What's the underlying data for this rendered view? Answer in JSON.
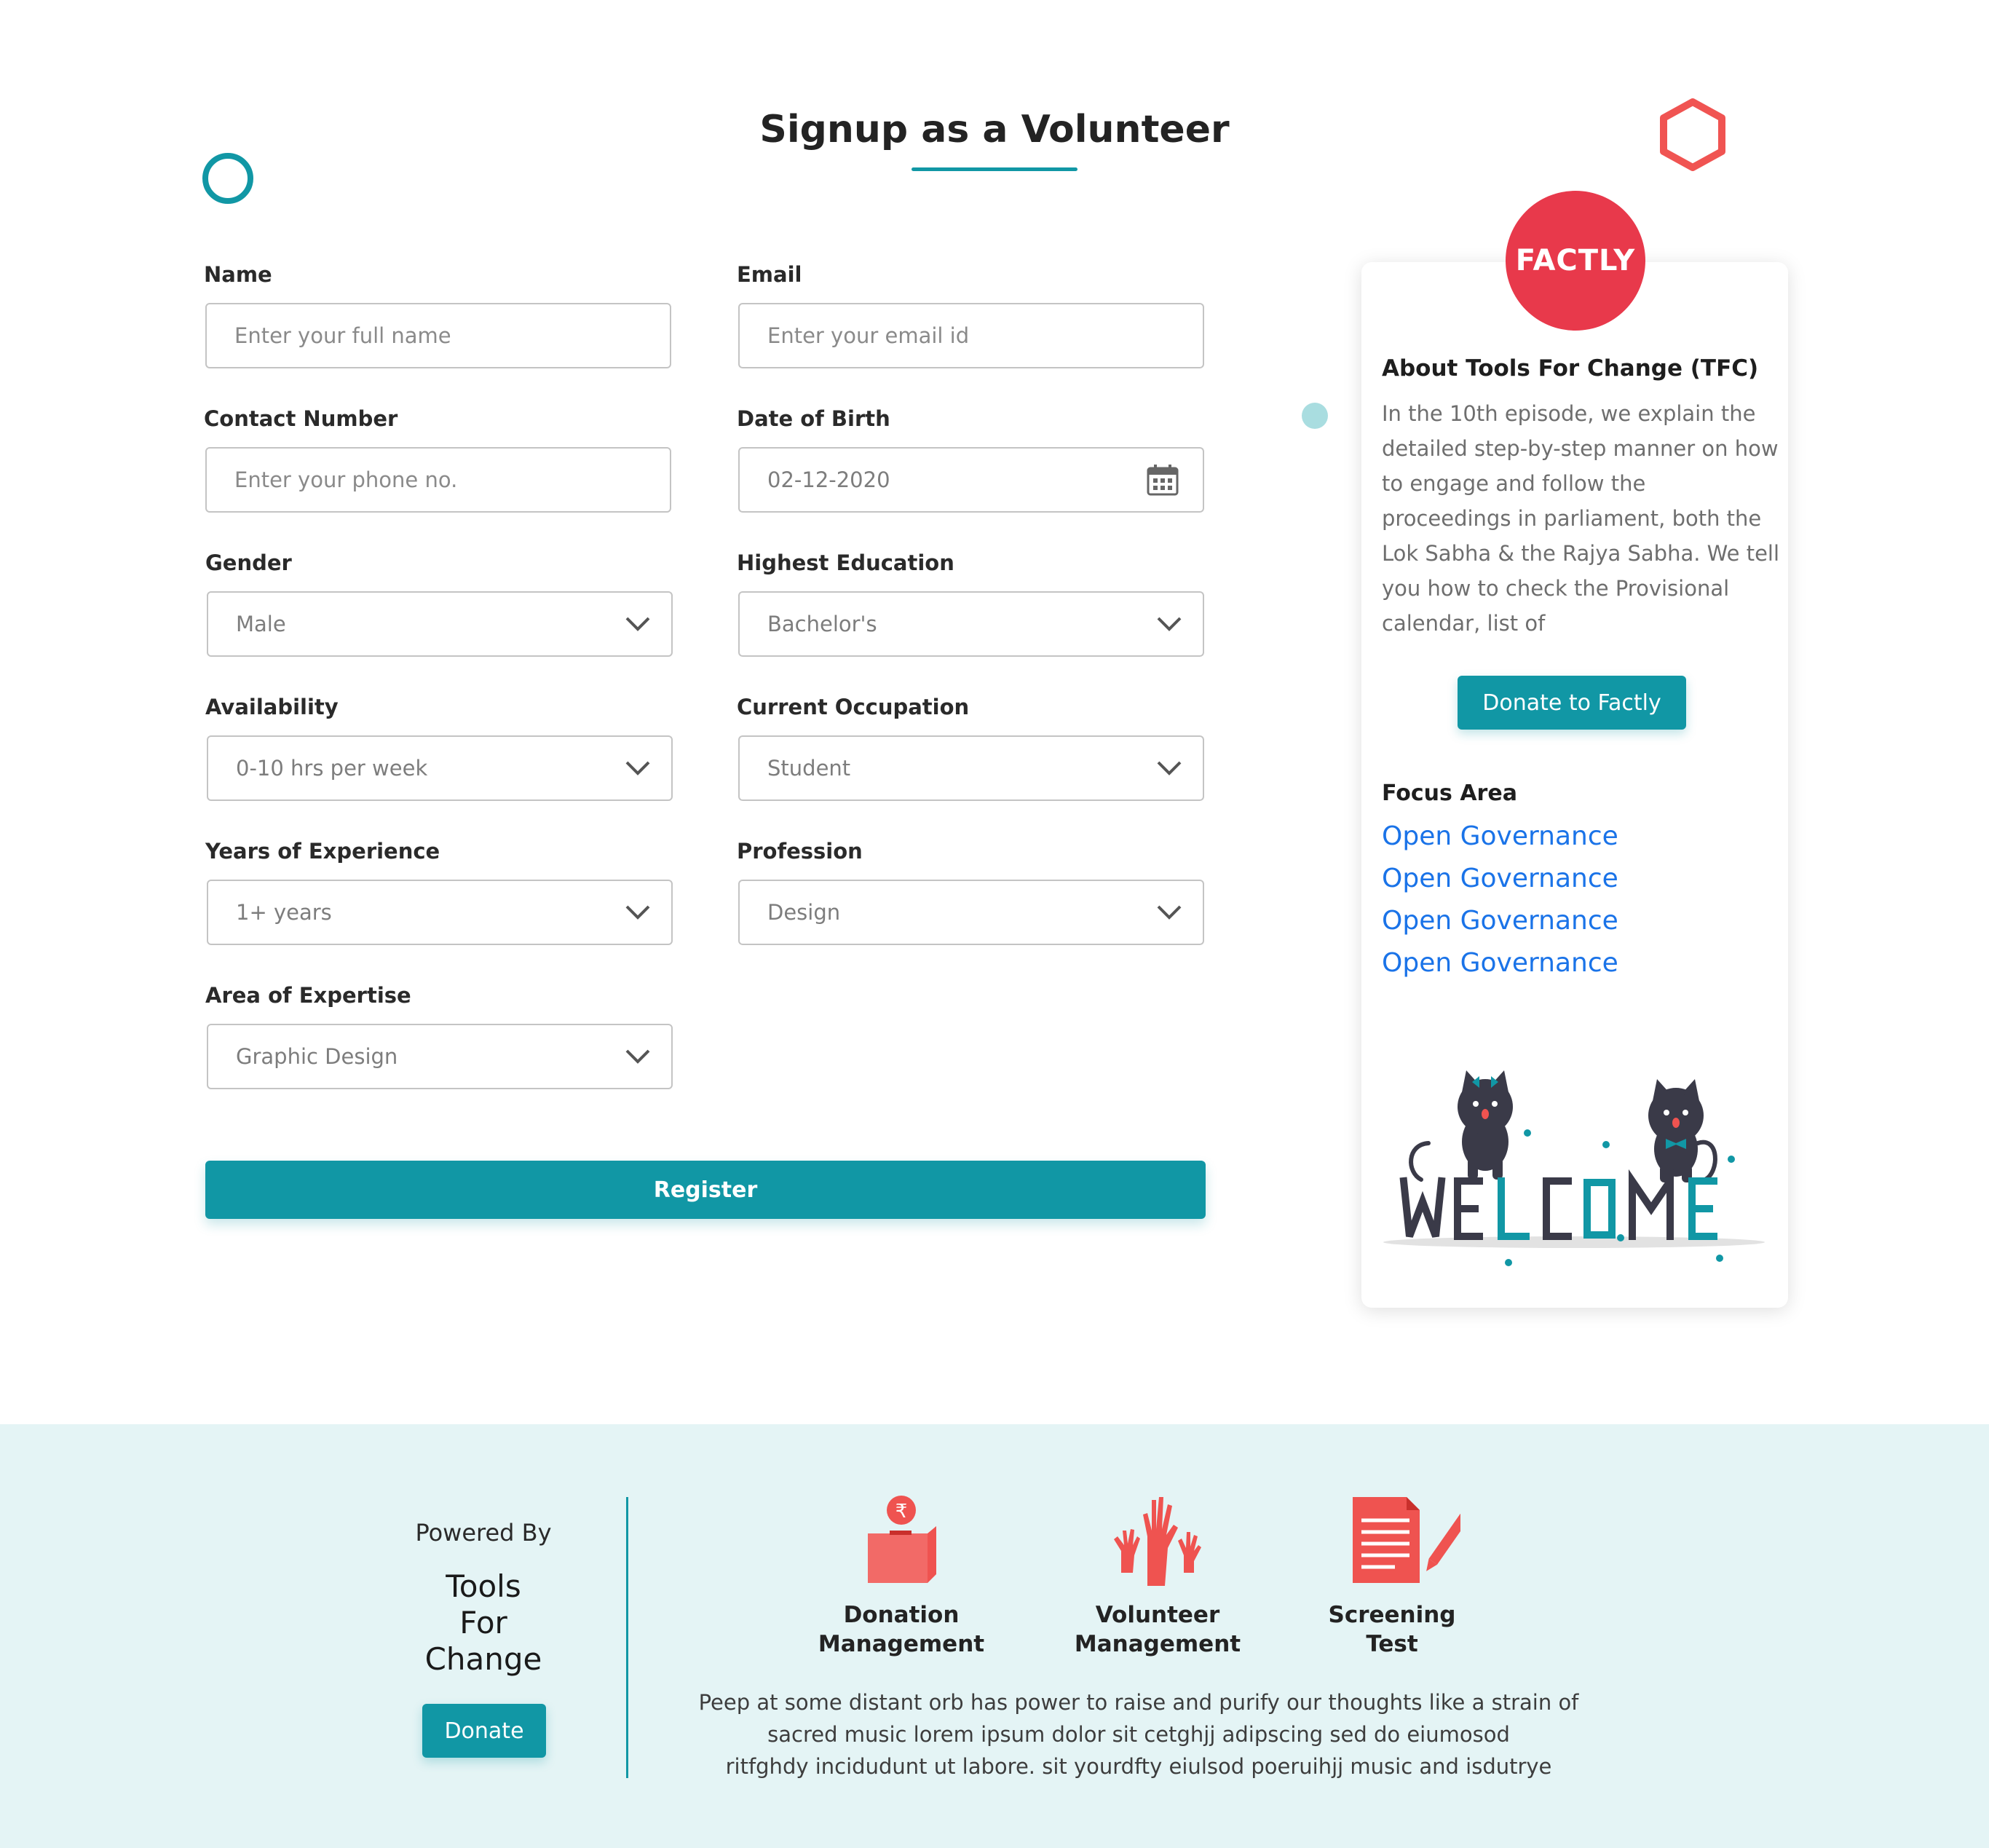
{
  "page": {
    "title": "Signup as a Volunteer"
  },
  "form": {
    "name": {
      "label": "Name",
      "placeholder": "Enter your full name"
    },
    "email": {
      "label": "Email",
      "placeholder": "Enter your email id"
    },
    "contact": {
      "label": "Contact Number",
      "placeholder": "Enter your phone no."
    },
    "dob": {
      "label": "Date of Birth",
      "value": "02-12-2020"
    },
    "gender": {
      "label": "Gender",
      "value": "Male"
    },
    "education": {
      "label": "Highest Education",
      "value": "Bachelor's"
    },
    "availability": {
      "label": "Availability",
      "value": "0-10 hrs per week"
    },
    "occupation": {
      "label": "Current Occupation",
      "value": "Student"
    },
    "experience": {
      "label": "Years of Experience",
      "value": "1+ years"
    },
    "profession": {
      "label": "Profession",
      "value": "Design"
    },
    "expertise": {
      "label": "Area of Expertise",
      "value": "Graphic Design"
    },
    "register_label": "Register"
  },
  "sidebar": {
    "logo_text": "FACTLY",
    "about_title": "About Tools For Change (TFC)",
    "about_text": "In the 10th episode, we explain the detailed step-by-step manner on how to engage and follow the proceedings in parliament, both the Lok Sabha & the Rajya Sabha. We tell you how to check the Provisional calendar, list of",
    "donate_label": "Donate to Factly",
    "focus_title": "Focus Area",
    "focus_links": [
      "Open Governance",
      "Open Governance",
      "Open Governance",
      "Open Governance"
    ],
    "welcome_text": "WELCOME"
  },
  "footer": {
    "powered_by": "Powered By",
    "brand_lines": [
      "Tools",
      "For",
      "Change"
    ],
    "donate_label": "Donate",
    "features": [
      {
        "line1": "Donation",
        "line2": "Management",
        "icon": "donation-box-icon"
      },
      {
        "line1": "Volunteer",
        "line2": "Management",
        "icon": "raised-hands-icon"
      },
      {
        "line1": "Screening",
        "line2": "Test",
        "icon": "test-sheet-icon"
      }
    ],
    "text_lines": [
      "Peep at some distant orb has power to raise and purify our thoughts like a strain of",
      "sacred music lorem ipsum dolor sit  cetghjj adipscing sed do eiumosod",
      "ritfghdy incidudunt ut labore. sit yourdfty eiulsod poeruihjj  music and isdutrye"
    ]
  },
  "colors": {
    "accent": "#1197a5",
    "brand_red": "#e8394b",
    "icon_red": "#ef5350",
    "link": "#1a73e8",
    "footer_bg": "#e4f4f5"
  }
}
